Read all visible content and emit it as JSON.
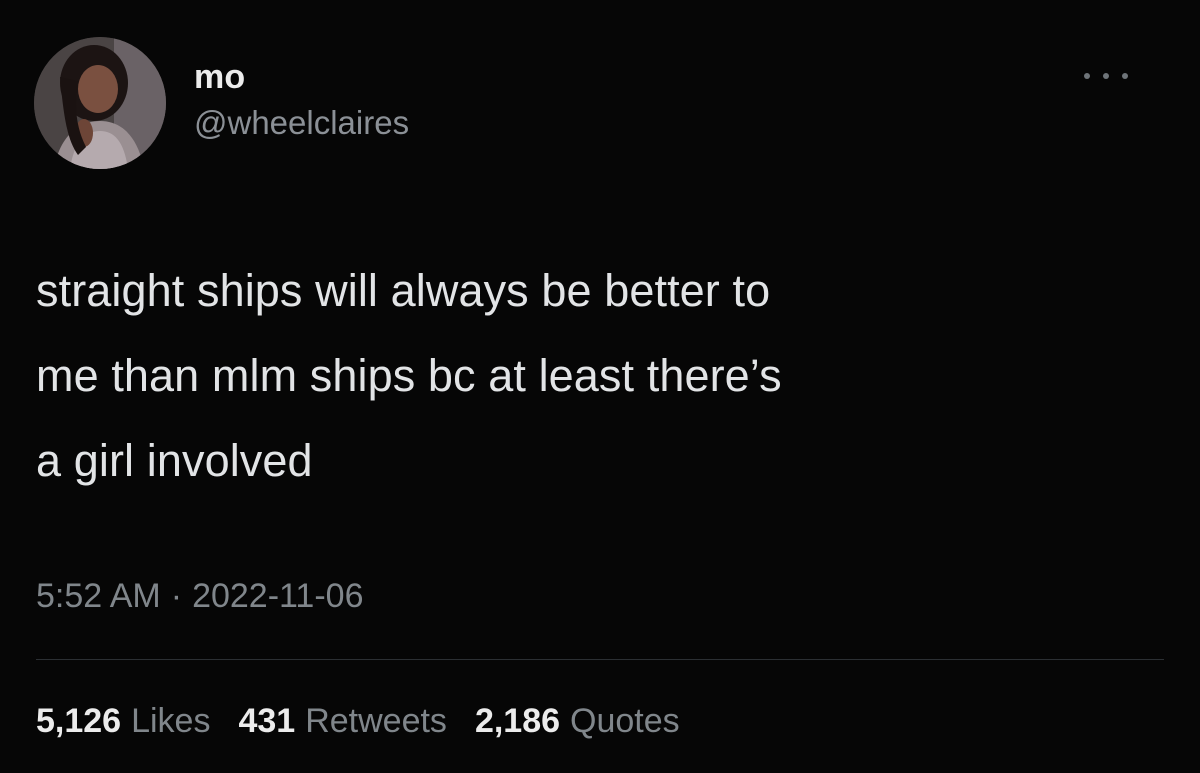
{
  "tweet": {
    "author": {
      "display_name": "mo",
      "handle": "@wheelclaires",
      "avatar_icon": "profile-photo"
    },
    "more_icon": "more-options-icon",
    "text_lines": [
      "straight ships will always be better to",
      "me than mlm ships bc at least there’s",
      "a girl involved"
    ],
    "time": "5:52 AM",
    "separator": "·",
    "date": "2022-11-06",
    "stats": {
      "likes": {
        "count": "5,126",
        "label": "Likes"
      },
      "retweets": {
        "count": "431",
        "label": "Retweets"
      },
      "quotes": {
        "count": "2,186",
        "label": "Quotes"
      }
    }
  },
  "colors": {
    "background": "#060606",
    "primary_text": "#e2e4e6",
    "secondary_text": "#80868b",
    "divider": "#2b2f33"
  }
}
